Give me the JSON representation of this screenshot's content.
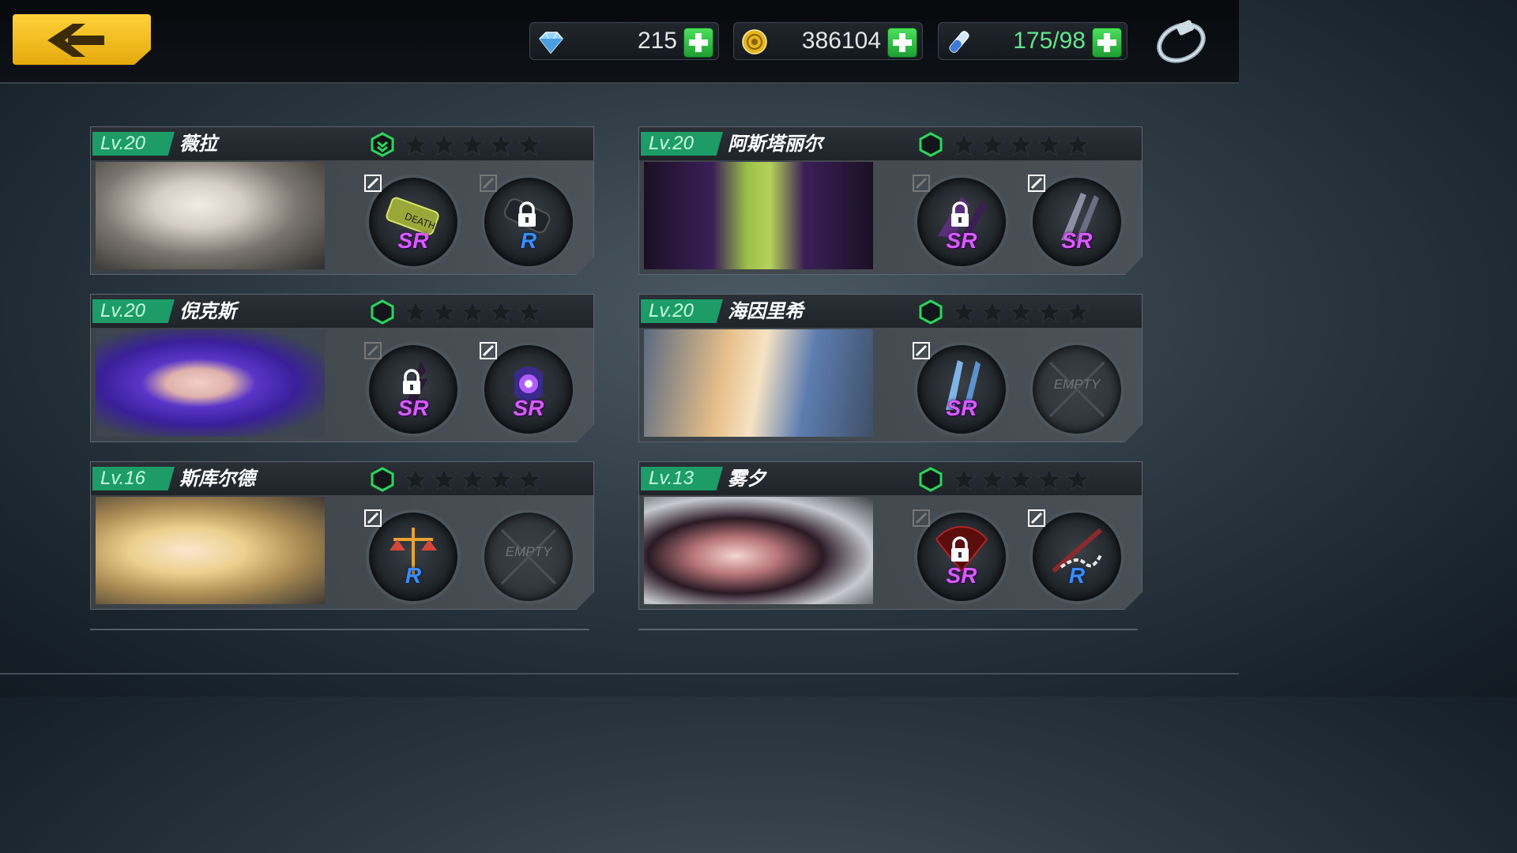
{
  "header": {
    "back_icon": "chevron-left-icon",
    "resources": [
      {
        "name": "crystal",
        "icon": "crystal-icon",
        "value": "215"
      },
      {
        "name": "gold",
        "icon": "coin-icon",
        "value": "386104"
      },
      {
        "name": "stamina",
        "icon": "vial-icon",
        "value": "175/98"
      }
    ],
    "ring_icon": "ring-icon"
  },
  "characters": [
    {
      "level": "Lv.20",
      "name": "薇拉",
      "stars_filled": 0,
      "stars_total": 5,
      "hex_upgrade": true,
      "equip": [
        {
          "rarity": "SR",
          "locked": false,
          "empty": false,
          "editable": true,
          "item": "bomb-canister"
        },
        {
          "rarity": "R",
          "locked": true,
          "empty": false,
          "editable": false,
          "item": "gun"
        }
      ]
    },
    {
      "level": "Lv.20",
      "name": "阿斯塔丽尔",
      "stars_filled": 0,
      "stars_total": 5,
      "hex_upgrade": false,
      "equip": [
        {
          "rarity": "SR",
          "locked": true,
          "empty": false,
          "editable": false,
          "item": "claw"
        },
        {
          "rarity": "SR",
          "locked": false,
          "empty": false,
          "editable": true,
          "item": "blades"
        }
      ]
    },
    {
      "level": "Lv.20",
      "name": "倪克斯",
      "stars_filled": 0,
      "stars_total": 5,
      "hex_upgrade": false,
      "equip": [
        {
          "rarity": "SR",
          "locked": true,
          "empty": false,
          "editable": false,
          "item": "thorn"
        },
        {
          "rarity": "SR",
          "locked": false,
          "empty": false,
          "editable": true,
          "item": "orb-device"
        }
      ]
    },
    {
      "level": "Lv.20",
      "name": "海因里希",
      "stars_filled": 0,
      "stars_total": 5,
      "hex_upgrade": false,
      "equip": [
        {
          "rarity": "SR",
          "locked": false,
          "empty": false,
          "editable": true,
          "item": "twin-blades"
        },
        {
          "rarity": "",
          "locked": false,
          "empty": true,
          "editable": false,
          "item": ""
        }
      ]
    },
    {
      "level": "Lv.16",
      "name": "斯库尔德",
      "stars_filled": 0,
      "stars_total": 5,
      "hex_upgrade": false,
      "equip": [
        {
          "rarity": "R",
          "locked": false,
          "empty": false,
          "editable": true,
          "item": "scales"
        },
        {
          "rarity": "",
          "locked": false,
          "empty": true,
          "editable": false,
          "item": ""
        }
      ]
    },
    {
      "level": "Lv.13",
      "name": "雾夕",
      "stars_filled": 0,
      "stars_total": 5,
      "hex_upgrade": false,
      "equip": [
        {
          "rarity": "SR",
          "locked": true,
          "empty": false,
          "editable": false,
          "item": "feather-fan"
        },
        {
          "rarity": "R",
          "locked": false,
          "empty": false,
          "editable": true,
          "item": "chain-staff"
        }
      ]
    }
  ],
  "empty_label": "EMPTY",
  "colors": {
    "level_bg": "#1d9c68",
    "hex_green": "#29d65b",
    "sr": "#d75cff",
    "r": "#3a8cff",
    "back_btn": "#f5c322"
  }
}
